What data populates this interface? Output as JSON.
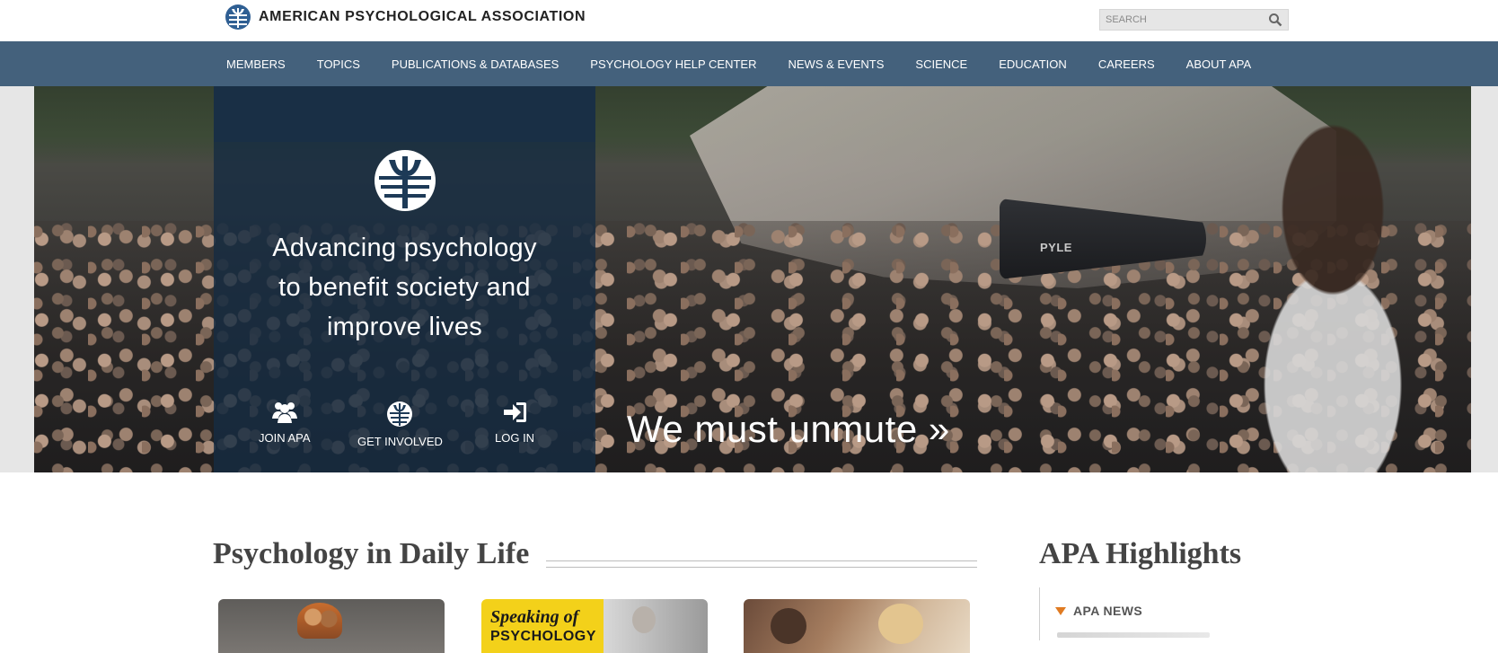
{
  "header": {
    "org_name": "AMERICAN PSYCHOLOGICAL ASSOCIATION",
    "search_placeholder": "SEARCH"
  },
  "nav": {
    "items": [
      {
        "label": "MEMBERS"
      },
      {
        "label": "TOPICS"
      },
      {
        "label": "PUBLICATIONS & DATABASES"
      },
      {
        "label": "PSYCHOLOGY HELP CENTER"
      },
      {
        "label": "NEWS & EVENTS"
      },
      {
        "label": "SCIENCE"
      },
      {
        "label": "EDUCATION"
      },
      {
        "label": "CAREERS"
      },
      {
        "label": "ABOUT APA"
      }
    ]
  },
  "hero": {
    "tagline_lines": [
      "Advancing psychology",
      "to benefit society and",
      "improve lives"
    ],
    "actions": [
      {
        "label": "JOIN APA",
        "icon": "users-icon"
      },
      {
        "label": "GET INVOLVED",
        "icon": "apa-logo-icon"
      },
      {
        "label": "LOG IN",
        "icon": "sign-in-icon"
      }
    ],
    "cta": "We must unmute »",
    "megaphone_brand": "PYLE"
  },
  "main": {
    "section_title": "Psychology in Daily Life",
    "cards": [
      {
        "name": "children-story-card"
      },
      {
        "name": "speaking-of-psychology-card",
        "title_line1": "Speaking of",
        "title_line2": "PSYCHOLOGY"
      },
      {
        "name": "family-photo-card"
      }
    ]
  },
  "sidebar": {
    "title": "APA Highlights",
    "news_label": "APA NEWS"
  },
  "colors": {
    "nav_bg": "#44617c",
    "panel_bg": "#162c42",
    "accent_orange": "#e07b22",
    "speaking_yellow": "#f3d11a"
  }
}
